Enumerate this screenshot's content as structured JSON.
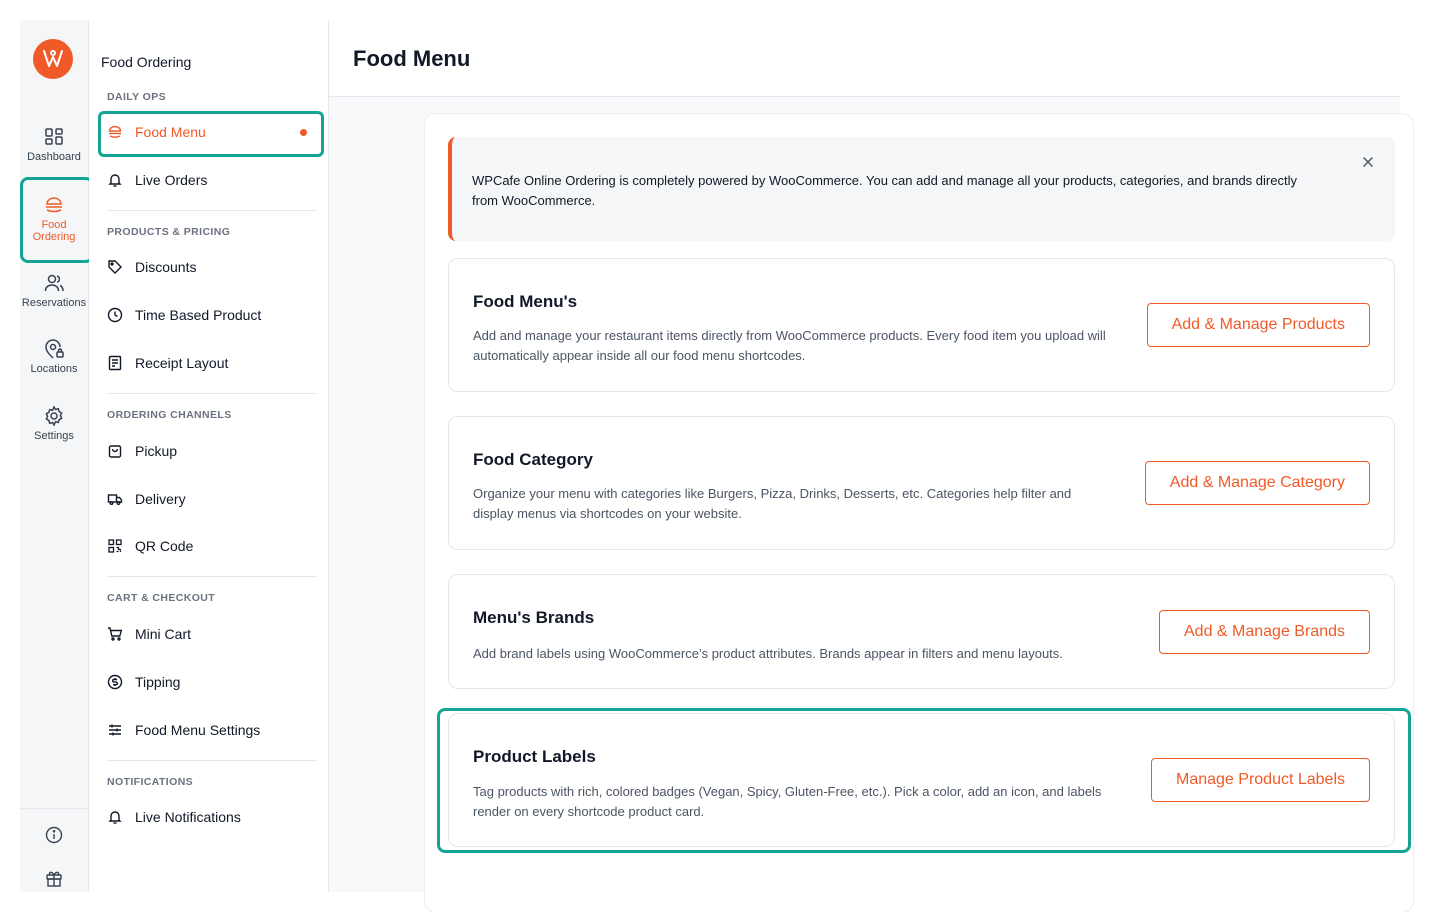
{
  "rail": {
    "items": [
      {
        "label": "Dashboard",
        "icon": "dashboard-icon"
      },
      {
        "label": "Food Ordering",
        "icon": "food-ordering-icon"
      },
      {
        "label": "Reservations",
        "icon": "users-icon"
      },
      {
        "label": "Locations",
        "icon": "location-pin-icon"
      },
      {
        "label": "Settings",
        "icon": "gear-icon"
      }
    ],
    "active": "Food Ordering"
  },
  "subnav": {
    "title": "Food Ordering",
    "sections": [
      {
        "label": "DAILY OPS",
        "items": [
          {
            "label": "Food Menu",
            "icon": "burger-icon"
          },
          {
            "label": "Live Orders",
            "icon": "bell-icon"
          }
        ]
      },
      {
        "label": "PRODUCTS & PRICING",
        "items": [
          {
            "label": "Discounts",
            "icon": "tag-icon"
          },
          {
            "label": "Time Based Product",
            "icon": "clock-icon"
          },
          {
            "label": "Receipt Layout",
            "icon": "receipt-icon"
          }
        ]
      },
      {
        "label": "ORDERING CHANNELS",
        "items": [
          {
            "label": "Pickup",
            "icon": "bag-icon"
          },
          {
            "label": "Delivery",
            "icon": "truck-icon"
          },
          {
            "label": "QR Code",
            "icon": "qr-code-icon"
          }
        ]
      },
      {
        "label": "CART & CHECKOUT",
        "items": [
          {
            "label": "Mini Cart",
            "icon": "cart-icon"
          },
          {
            "label": "Tipping",
            "icon": "dollar-circle-icon"
          },
          {
            "label": "Food Menu Settings",
            "icon": "sliders-icon"
          }
        ]
      },
      {
        "label": "NOTIFICATIONS",
        "items": [
          {
            "label": "Live Notifications",
            "icon": "bell-icon"
          }
        ]
      }
    ]
  },
  "header": {
    "title": "Food Menu"
  },
  "notice": {
    "text": "WPCafe Online Ordering is completely powered by WooCommerce. You can add and manage all your products, categories, and brands directly from WooCommerce."
  },
  "cards": [
    {
      "title": "Food Menu's",
      "desc": "Add and manage your restaurant items directly from WooCommerce products. Every food item you upload will automatically appear inside all our food menu shortcodes.",
      "button": "Add & Manage Products"
    },
    {
      "title": "Food Category",
      "desc": "Organize your menu with categories like Burgers, Pizza, Drinks, Desserts, etc. Categories help filter and display menus via shortcodes on your website.",
      "button": "Add & Manage Category"
    },
    {
      "title": "Menu's Brands",
      "desc": "Add brand labels using WooCommerce’s product attributes. Brands appear in filters and menu layouts.",
      "button": "Add & Manage Brands"
    },
    {
      "title": "Product Labels",
      "desc": "Tag products with rich, colored badges (Vegan, Spicy, Gluten-Free, etc.). Pick a color, add an icon, and labels render on every shortcode product card.",
      "button": "Manage Product Labels"
    }
  ],
  "colors": {
    "accent": "#f05a28",
    "highlight": "#14a394"
  }
}
